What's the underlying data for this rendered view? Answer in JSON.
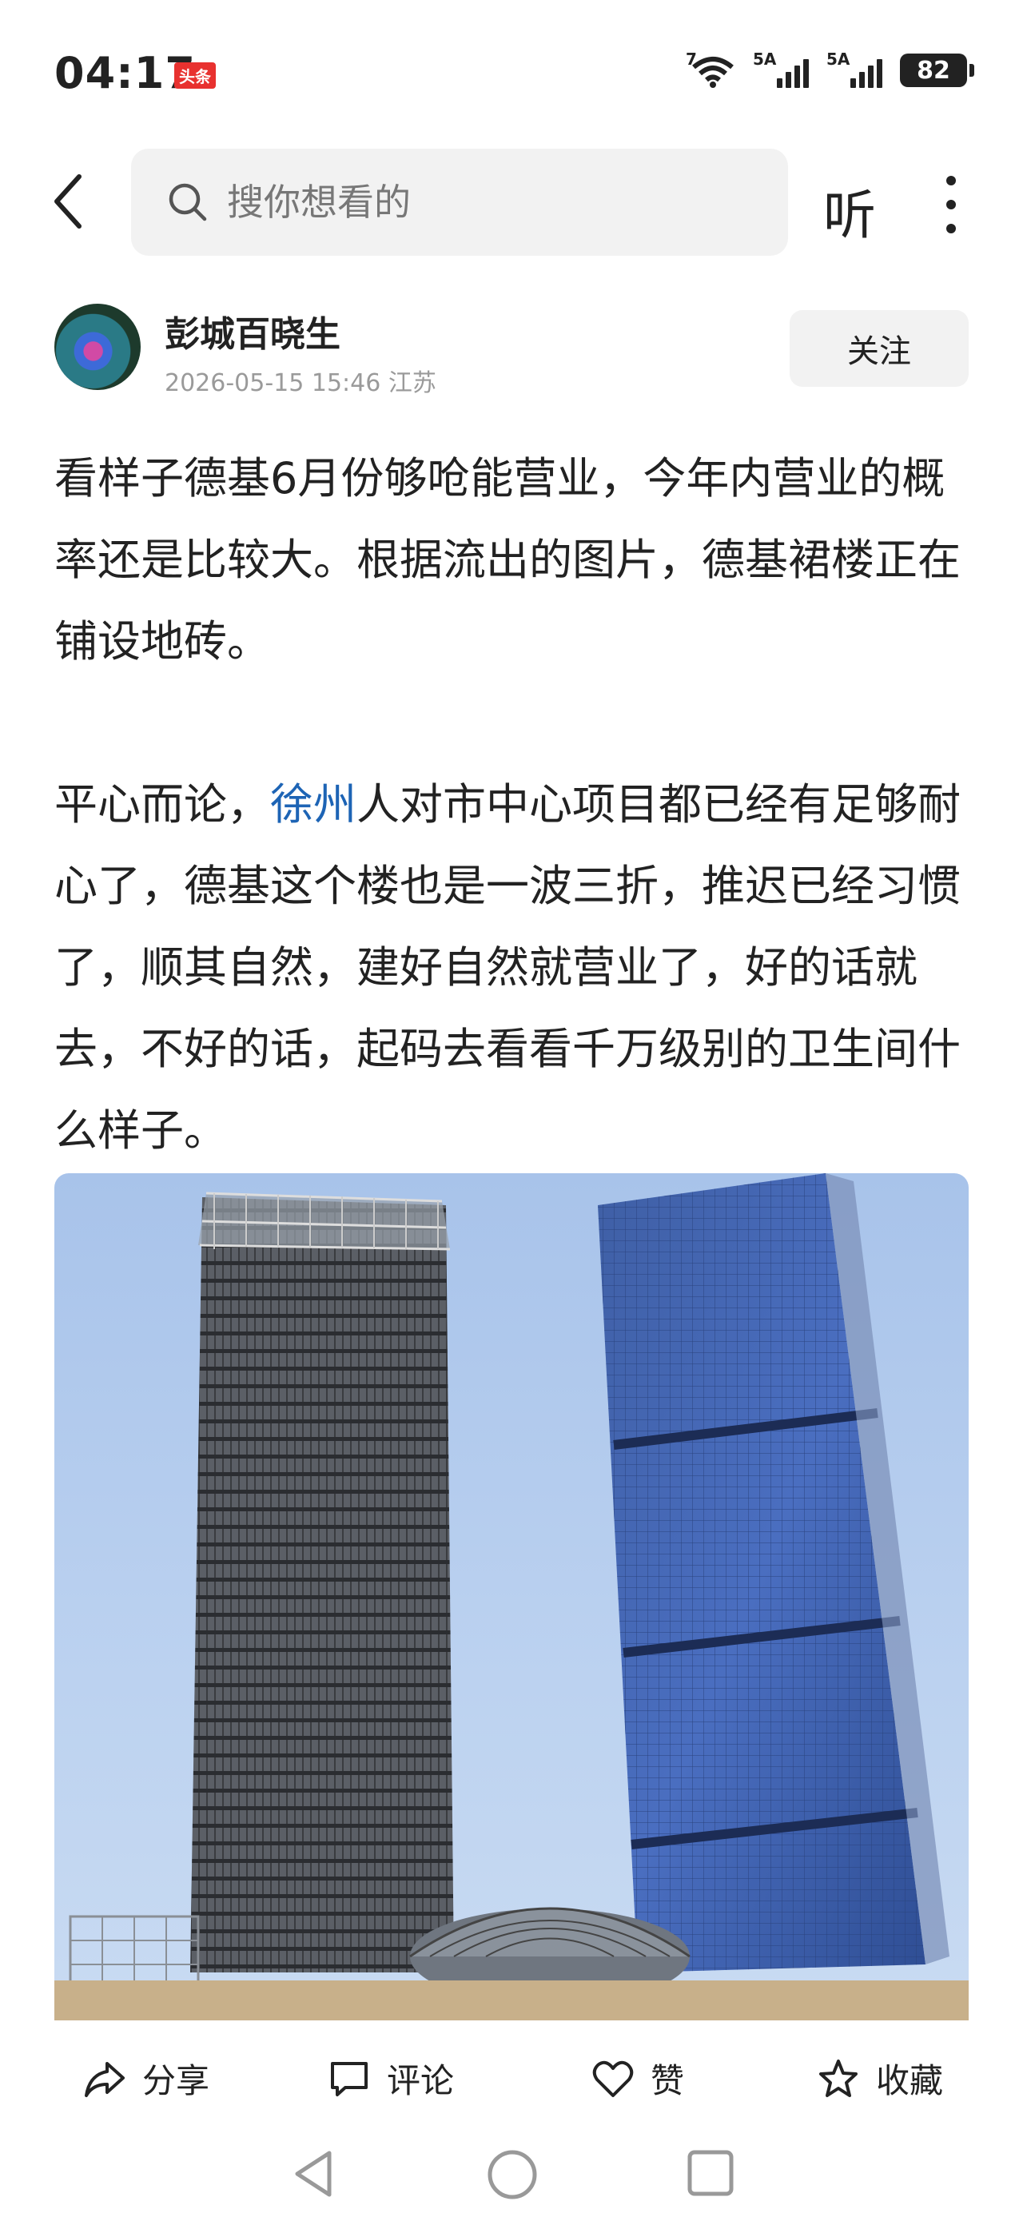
{
  "status_bar": {
    "time": "04:17",
    "app_badge": "头条",
    "wifi_label": "7",
    "sim1_label": "5A",
    "sim2_label": "5A",
    "battery": "82"
  },
  "topnav": {
    "search_placeholder": "搜你想看的",
    "listen_label": "听",
    "icons": [
      "back-arrow-icon",
      "search-icon",
      "more-vertical-icon"
    ]
  },
  "author": {
    "name": "彭城百晓生",
    "date": "2026-05-15 15:46",
    "location": "江苏",
    "follow_label": "关注"
  },
  "article": {
    "para1": "看样子德基6月份够呛能营业，今年内营业的概率还是比较大。根据流出的图片，德基裙楼正在铺设地砖。",
    "para2_prefix": "平心而论，",
    "para2_link": "徐州",
    "para2_rest": "人对市中心项目都已经有足够耐心了，德基这个楼也是一波三折，推迟已经习惯了，顺其自然，建好自然就营业了，好的话就去，不好的话，起码去看看千万级别的卫生间什么样子。"
  },
  "actions": {
    "share": "分享",
    "comment": "评论",
    "like": "赞",
    "favorite": "收藏"
  },
  "colors": {
    "link": "#1d64b5",
    "badge": "#e8312f",
    "muted": "#9a9a9a"
  }
}
